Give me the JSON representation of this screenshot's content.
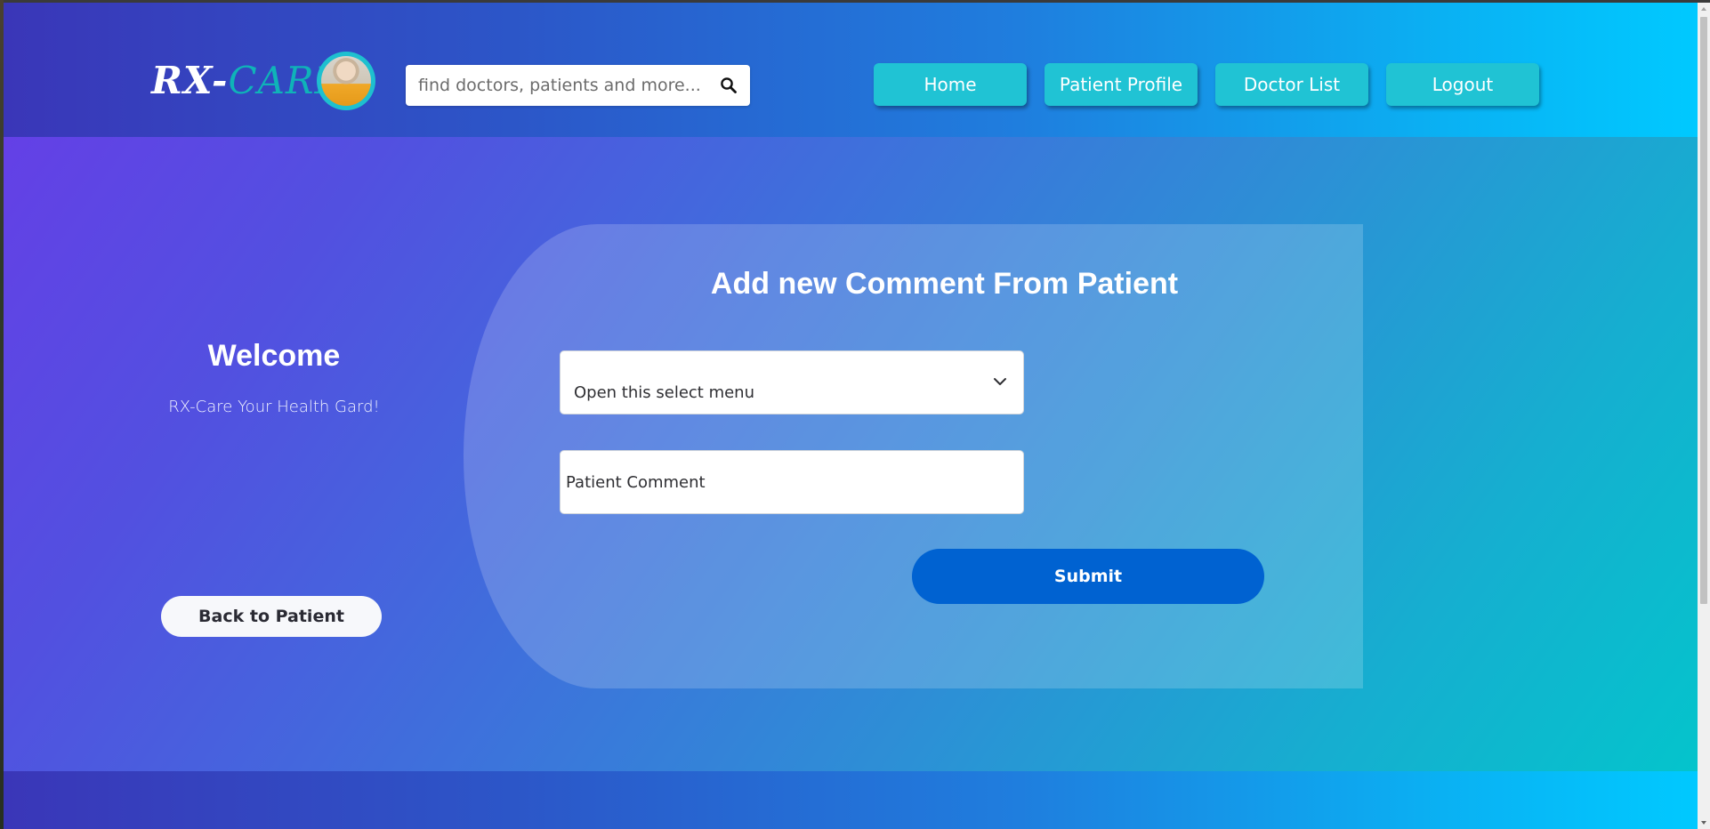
{
  "header": {
    "logo_prefix": "RX-",
    "logo_suffix": "CARE",
    "search": {
      "placeholder": "find doctors, patients and more...",
      "icon": "search-icon"
    },
    "nav": [
      {
        "label": "Home"
      },
      {
        "label": "Patient Profile"
      },
      {
        "label": "Doctor List"
      },
      {
        "label": "Logout"
      }
    ]
  },
  "sidebar": {
    "welcome_title": "Welcome",
    "welcome_subtitle": "RX-Care Your Health Gard!",
    "back_button_label": "Back to Patient"
  },
  "form": {
    "title": "Add new Comment From Patient",
    "select_value": "Open this select menu",
    "comment_placeholder": "Patient Comment",
    "submit_label": "Submit"
  },
  "colors": {
    "nav_button": "#20c3d4",
    "submit_button": "#0062d1",
    "logo_accent": "#0fb3b8"
  }
}
